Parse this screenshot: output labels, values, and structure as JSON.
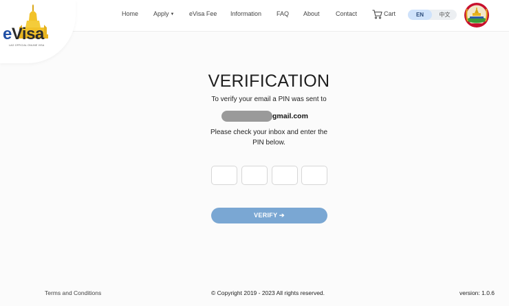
{
  "header": {
    "logo": {
      "brand_e": "e",
      "brand_visa": "Visa",
      "tagline": "LAO OFFICIAL ONLINE VISA"
    },
    "nav": {
      "home": "Home",
      "apply": "Apply",
      "evisa_fee": "eVisa Fee",
      "information": "Information",
      "faq": "FAQ",
      "about": "About",
      "contact": "Contact",
      "cart": "Cart"
    },
    "language": {
      "en": "EN",
      "zh": "中文",
      "selected": "EN"
    }
  },
  "main": {
    "title": "VERIFICATION",
    "instruction": "To verify your email a PIN was sent to",
    "email_domain": "gmail.com",
    "check_inbox": "Please check your inbox and enter the PIN below.",
    "pin_values": [
      "",
      "",
      "",
      ""
    ],
    "verify_label": "VERIFY ➔"
  },
  "footer": {
    "terms": "Terms and Conditions",
    "copyright": "© Copyright 2019 - 2023 All rights reserved.",
    "version": "version: 1.0.6"
  },
  "colors": {
    "accent": "#7aa7d3",
    "lang_selected_bg": "#cfe2fb",
    "brand_blue": "#1f4fa5",
    "stupa_gold": "#f2c22a"
  },
  "icons": [
    "stupa-logo-icon",
    "caret-down-icon",
    "cart-icon",
    "arrow-right-icon",
    "lao-emblem-icon"
  ]
}
